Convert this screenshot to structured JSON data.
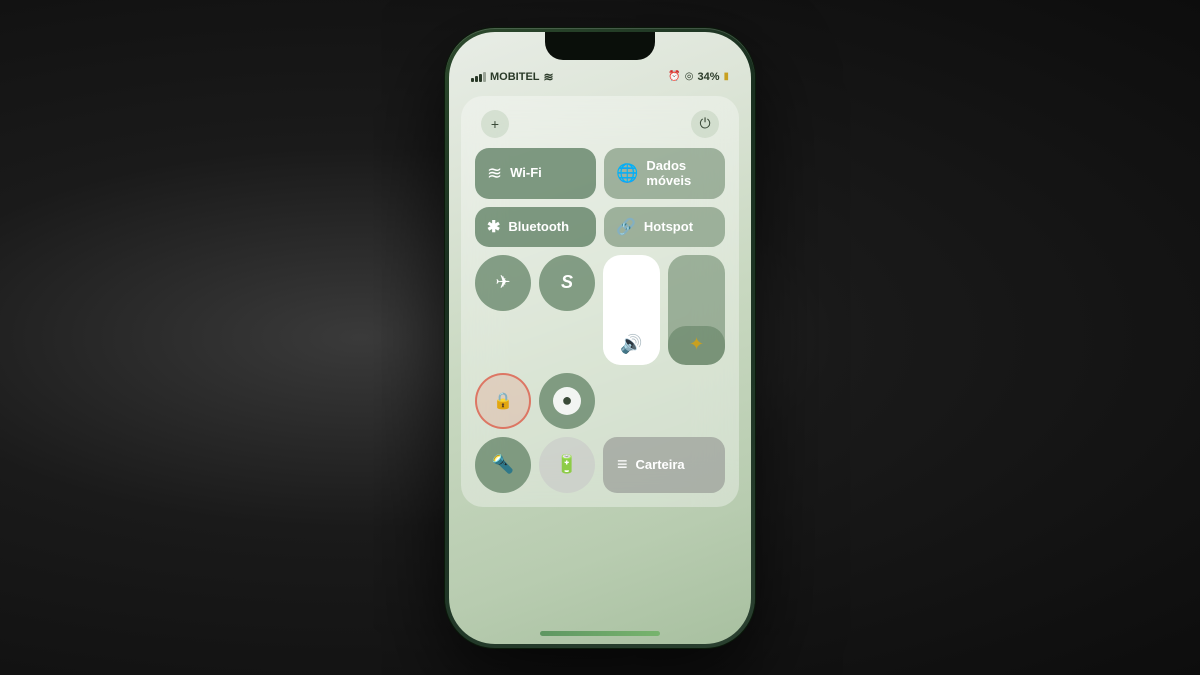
{
  "phone": {
    "carrier": "MOBITEL",
    "battery_percent": "34%",
    "top_icons": {
      "add_label": "+",
      "power_label": "⏻"
    },
    "control_center": {
      "wifi_label": "Wi-Fi",
      "mobile_data_label": "Dados móveis",
      "bluetooth_label": "Bluetooth",
      "hotspot_label": "Hotspot",
      "airplane_icon": "✈",
      "shazam_icon": "S",
      "lock_rotation_icon": "🔒",
      "focus_icon": "●",
      "flashlight_icon": "🔦",
      "battery_icon": "🔋",
      "wallet_label": "Carteira"
    }
  }
}
